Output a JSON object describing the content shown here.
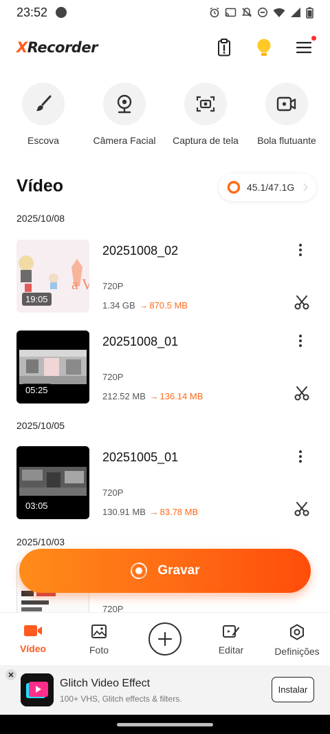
{
  "status_bar": {
    "time": "23:52"
  },
  "header": {
    "logo_prefix": "X",
    "logo_rest": "Recorder"
  },
  "tools": [
    {
      "label": "Escova",
      "icon": "brush-icon"
    },
    {
      "label": "Câmera Facial",
      "icon": "webcam-icon"
    },
    {
      "label": "Captura de tela",
      "icon": "screenshot-icon"
    },
    {
      "label": "Bola flutuante",
      "icon": "floating-ball-icon"
    }
  ],
  "video_section": {
    "title": "Vídeo",
    "storage": "45.1/47.1G"
  },
  "groups": [
    {
      "date": "2025/10/08",
      "items": [
        {
          "title": "20251008_02",
          "duration": "19:05",
          "resolution": "720P",
          "size_original": "1.34 GB",
          "arrow": "→",
          "size_compressed": "870.5 MB"
        },
        {
          "title": "20251008_01",
          "duration": "05:25",
          "resolution": "720P",
          "size_original": "212.52 MB",
          "arrow": "→",
          "size_compressed": "136.14 MB"
        }
      ]
    },
    {
      "date": "2025/10/05",
      "items": [
        {
          "title": "20251005_01",
          "duration": "03:05",
          "resolution": "720P",
          "size_original": "130.91 MB",
          "arrow": "→",
          "size_compressed": "83.78 MB"
        }
      ]
    },
    {
      "date": "2025/10/03",
      "items": [
        {
          "resolution": "720P"
        }
      ]
    }
  ],
  "record_button": {
    "label": "Gravar"
  },
  "bottom_nav": [
    {
      "label": "Vídeo",
      "icon": "video-camera-icon",
      "active": true
    },
    {
      "label": "Foto",
      "icon": "photo-icon",
      "active": false
    },
    {
      "label": "",
      "icon": "add-icon",
      "active": false
    },
    {
      "label": "Editar",
      "icon": "edit-icon",
      "active": false
    },
    {
      "label": "Definições",
      "icon": "settings-icon",
      "active": false
    }
  ],
  "ad": {
    "title": "Glitch Video Effect",
    "subtitle": "100+ VHS, Glitch effects & filters.",
    "button": "Instalar"
  },
  "colors": {
    "accent": "#ff5a1f",
    "record_gradient_start": "#ff8c1a",
    "record_gradient_end": "#ff4d0a"
  }
}
